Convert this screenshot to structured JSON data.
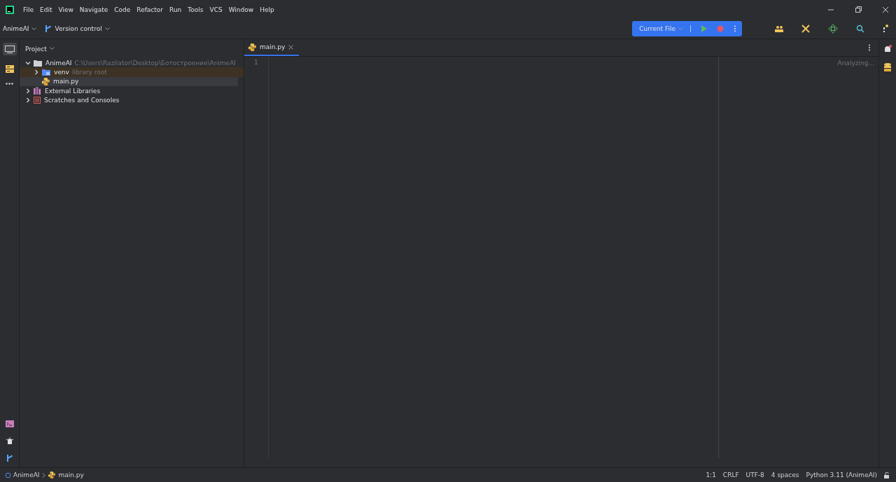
{
  "menu": [
    "File",
    "Edit",
    "View",
    "Navigate",
    "Code",
    "Refactor",
    "Run",
    "Tools",
    "VCS",
    "Window",
    "Help"
  ],
  "toolbar": {
    "project": "AnimeAI",
    "vcs": "Version control",
    "run_config": "Current File"
  },
  "project_panel": {
    "title": "Project",
    "tree": [
      {
        "label": "AnimeAI",
        "hint": "C:\\Users\\Razilator\\Desktop\\Ботостроение\\AnimeAI",
        "kind": "folder",
        "expanded": true,
        "selected": false,
        "highlighted": false,
        "children": [
          {
            "label": "venv",
            "hint": "library root",
            "kind": "venv",
            "expanded": false,
            "selected": false,
            "highlighted": true
          },
          {
            "label": "main.py",
            "kind": "python",
            "selected": true,
            "highlighted": false
          }
        ]
      },
      {
        "label": "External Libraries",
        "kind": "library",
        "expanded": false,
        "selected": false,
        "highlighted": false
      },
      {
        "label": "Scratches and Consoles",
        "kind": "scratches",
        "expanded": false,
        "selected": false,
        "highlighted": false
      }
    ]
  },
  "editor": {
    "tabs": [
      {
        "label": "main.py",
        "selected": true
      }
    ],
    "line_numbers": [
      "1"
    ],
    "status": "Analyzing..."
  },
  "status_bar": {
    "breadcrumbs": [
      "AnimeAI",
      "main.py"
    ],
    "items": [
      "1:1",
      "CRLF",
      "UTF-8",
      "4 spaces",
      "Python 3.11 (AnimeAI)"
    ]
  }
}
